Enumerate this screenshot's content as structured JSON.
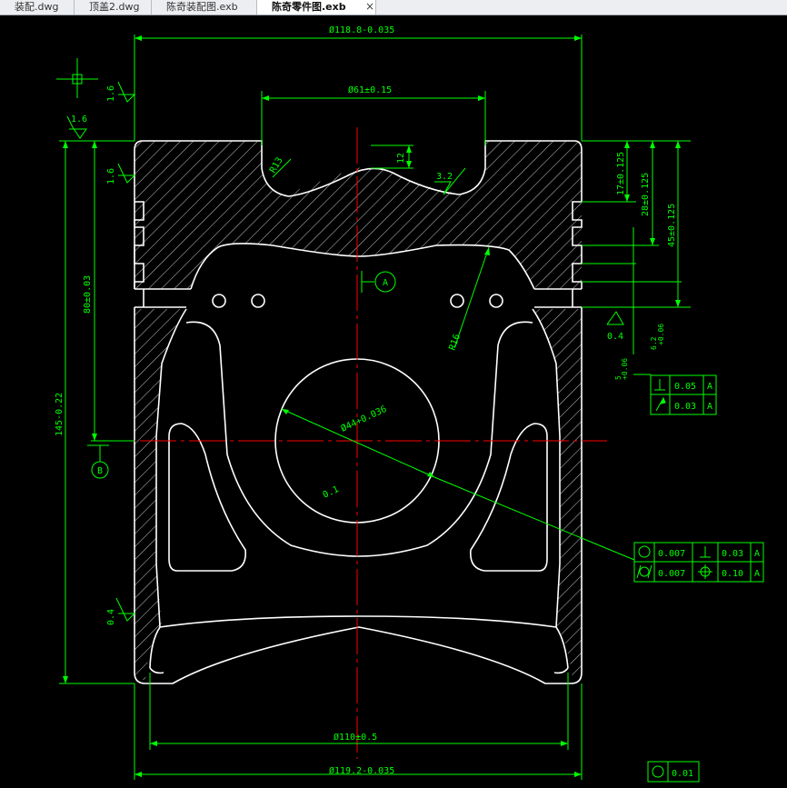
{
  "tabs": [
    {
      "label": "装配.dwg",
      "active": false
    },
    {
      "label": "顶盖2.dwg",
      "active": false
    },
    {
      "label": "陈奇装配图.exb",
      "active": false
    },
    {
      "label": "陈奇零件图.exb",
      "active": true
    }
  ],
  "close_glyph": "×",
  "colors": {
    "background": "#000000",
    "part_outline": "#ffffff",
    "dimension": "#00ff00",
    "centerline": "#ff0000"
  },
  "drawing": {
    "dims": {
      "top_dia": "Ø118.8-0.035",
      "bowl_dia": "Ø61±0.15",
      "bottom_dia": "Ø110±0.5",
      "skirt_dia": "Ø119.2-0.035",
      "height_total": "145-0.22",
      "height_80": "80±0.03",
      "d17": "17±0.125",
      "d28": "28±0.125",
      "d45": "45±0.125",
      "d12": "12",
      "pin_dia": "Ø44+0.036",
      "r13": "R13",
      "r16": "R16",
      "groove_tol": "+0.06",
      "groove_tol2": "+0.06",
      "small_a": "6.2",
      "small_b": "5",
      "chamfer": "0.1"
    },
    "roughness": {
      "r1": "1.6",
      "r2": "1.6",
      "r3": "1.6",
      "r4": "3.2",
      "r5": "0.4",
      "r6": "0.4"
    },
    "datums": {
      "a": "A",
      "b": "B"
    },
    "tolerance_frames": {
      "perp_value": "0.05",
      "perp_datum": "A",
      "runout_value": "0.03",
      "runout_datum": "A",
      "round_value": "0.007",
      "cyl_value": "0.007",
      "perp2_value": "0.03",
      "perp2_datum": "A",
      "pos_value": "0.10",
      "pos_datum": "A",
      "bottom_round_value": "0.01"
    }
  }
}
